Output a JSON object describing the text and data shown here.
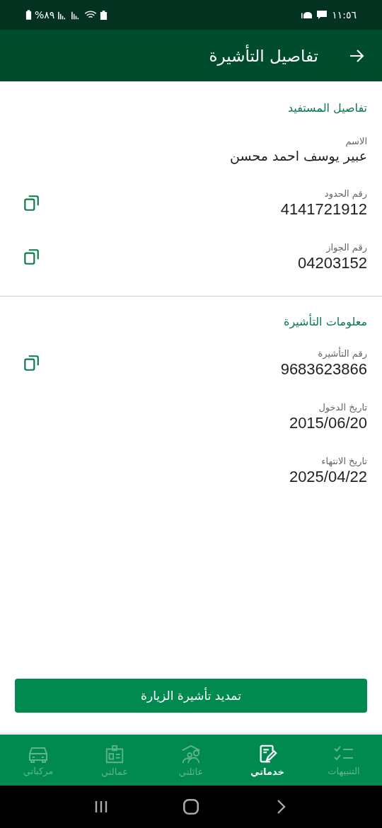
{
  "status_bar": {
    "time": "١١:٥٦",
    "battery": "%٨٩"
  },
  "header": {
    "title": "تفاصيل التأشيرة"
  },
  "sections": [
    {
      "title": "تفاصيل المستفيد",
      "fields": [
        {
          "label": "الاسم",
          "value": "عبير يوسف احمد محسن",
          "copyable": false,
          "numeric": false
        },
        {
          "label": "رقم الحدود",
          "value": "4141721912",
          "copyable": true,
          "numeric": true
        },
        {
          "label": "رقم الجواز",
          "value": "04203152",
          "copyable": true,
          "numeric": true
        }
      ]
    },
    {
      "title": "معلومات التأشيرة",
      "fields": [
        {
          "label": "رقم التأشيرة",
          "value": "9683623866",
          "copyable": true,
          "numeric": true
        },
        {
          "label": "تاريخ الدخول",
          "value": "2015/06/20",
          "copyable": false,
          "numeric": true
        },
        {
          "label": "تاريخ الانتهاء",
          "value": "2025/04/22",
          "copyable": false,
          "numeric": true
        }
      ]
    }
  ],
  "action_button": "تمديد تأشيرة الزيارة",
  "bottom_nav": [
    {
      "kind": "alerts",
      "label": "التنبيهات",
      "selected": false
    },
    {
      "kind": "services",
      "label": "خدماتي",
      "selected": true
    },
    {
      "kind": "family",
      "label": "عائلتي",
      "selected": false
    },
    {
      "kind": "workers",
      "label": "عمالتي",
      "selected": false
    },
    {
      "kind": "vehicles",
      "label": "مركباتي",
      "selected": false
    }
  ]
}
